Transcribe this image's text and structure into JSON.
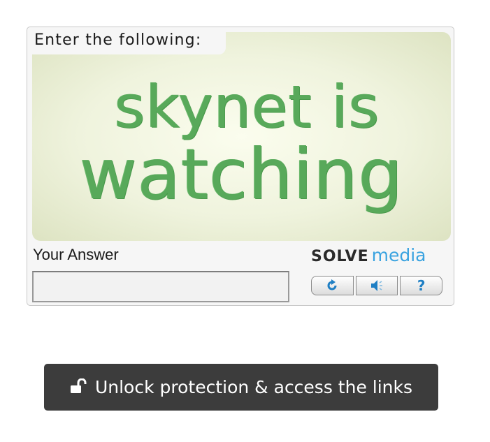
{
  "captcha": {
    "instruction": "Enter the following:",
    "image_text_line1": "skynet is",
    "image_text_line2": "watching",
    "answer_label": "Your Answer",
    "answer_value": "",
    "brand_solve": "SOLVE",
    "brand_media": "media",
    "controls": {
      "refresh_icon": "refresh-icon",
      "audio_icon": "speaker-icon",
      "help_icon": "help-icon",
      "help_glyph": "?"
    },
    "colors": {
      "captcha_text": "#58a95a",
      "brand_accent": "#3aa3e0"
    }
  },
  "unlock": {
    "label": "Unlock protection & access the links",
    "icon": "unlock-icon",
    "background": "#3c3c3c"
  }
}
